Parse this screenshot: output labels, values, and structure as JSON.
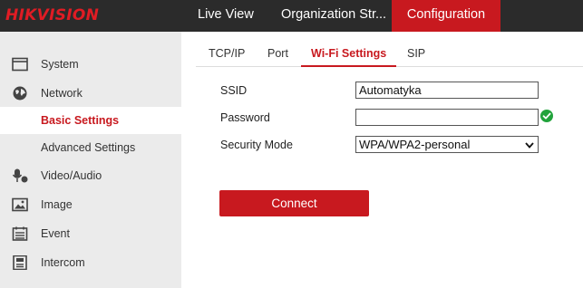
{
  "brand": {
    "logo_text": "HIKVISION",
    "accent": "#c8191f",
    "logo_color": "#e01c24"
  },
  "topnav": {
    "live_view": "Live View",
    "organization": "Organization Str...",
    "configuration": "Configuration"
  },
  "sidebar": {
    "items": [
      {
        "label": "System",
        "icon": "monitor-icon"
      },
      {
        "label": "Network",
        "icon": "globe-icon"
      },
      {
        "label": "Basic Settings",
        "icon": "",
        "active": true
      },
      {
        "label": "Advanced Settings",
        "icon": ""
      },
      {
        "label": "Video/Audio",
        "icon": "microphone-icon"
      },
      {
        "label": "Image",
        "icon": "image-icon"
      },
      {
        "label": "Event",
        "icon": "calendar-icon"
      },
      {
        "label": "Intercom",
        "icon": "intercom-icon"
      }
    ]
  },
  "tabs": [
    {
      "label": "TCP/IP"
    },
    {
      "label": "Port"
    },
    {
      "label": "Wi-Fi Settings",
      "active": true
    },
    {
      "label": "SIP"
    }
  ],
  "form": {
    "ssid_label": "SSID",
    "ssid_value": "Automatyka",
    "password_label": "Password",
    "password_value": "",
    "password_status_icon": "check-circle-icon",
    "security_label": "Security Mode",
    "security_value": "WPA/WPA2-personal"
  },
  "connect_label": "Connect",
  "colors": {
    "topbar_bg": "#2b2b2b",
    "sidebar_bg": "#ebebeb",
    "success_green": "#21a33b"
  }
}
